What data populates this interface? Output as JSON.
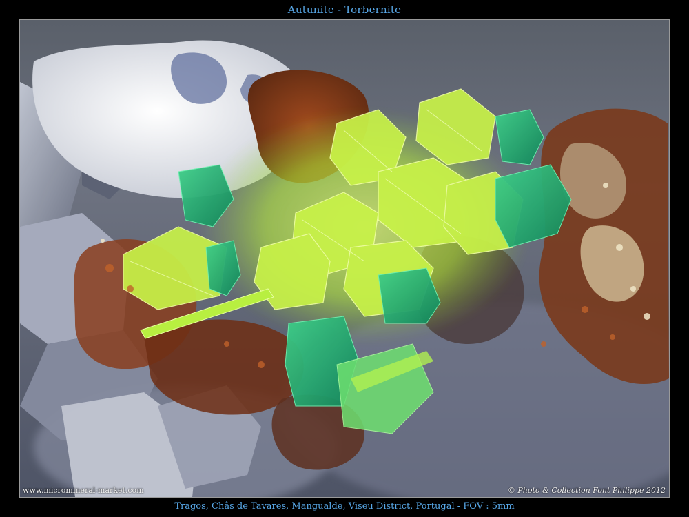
{
  "title": "Autunite - Torbernite",
  "photo": {
    "website": "www.micromineral-market.com",
    "credit": "© Photo & Collection Font Philippe 2012"
  },
  "caption": "Tragos, Châs de Tavares, Mangualde, Viseu District, Portugal - FOV : 5mm",
  "colors": {
    "caption_blue": "#58a8e8",
    "autunite_yellow_green": "#b8f040",
    "torbernite_green": "#1fa870",
    "matrix_rust": "#8a3a18",
    "quartz_gray": "#9aa0b0"
  }
}
